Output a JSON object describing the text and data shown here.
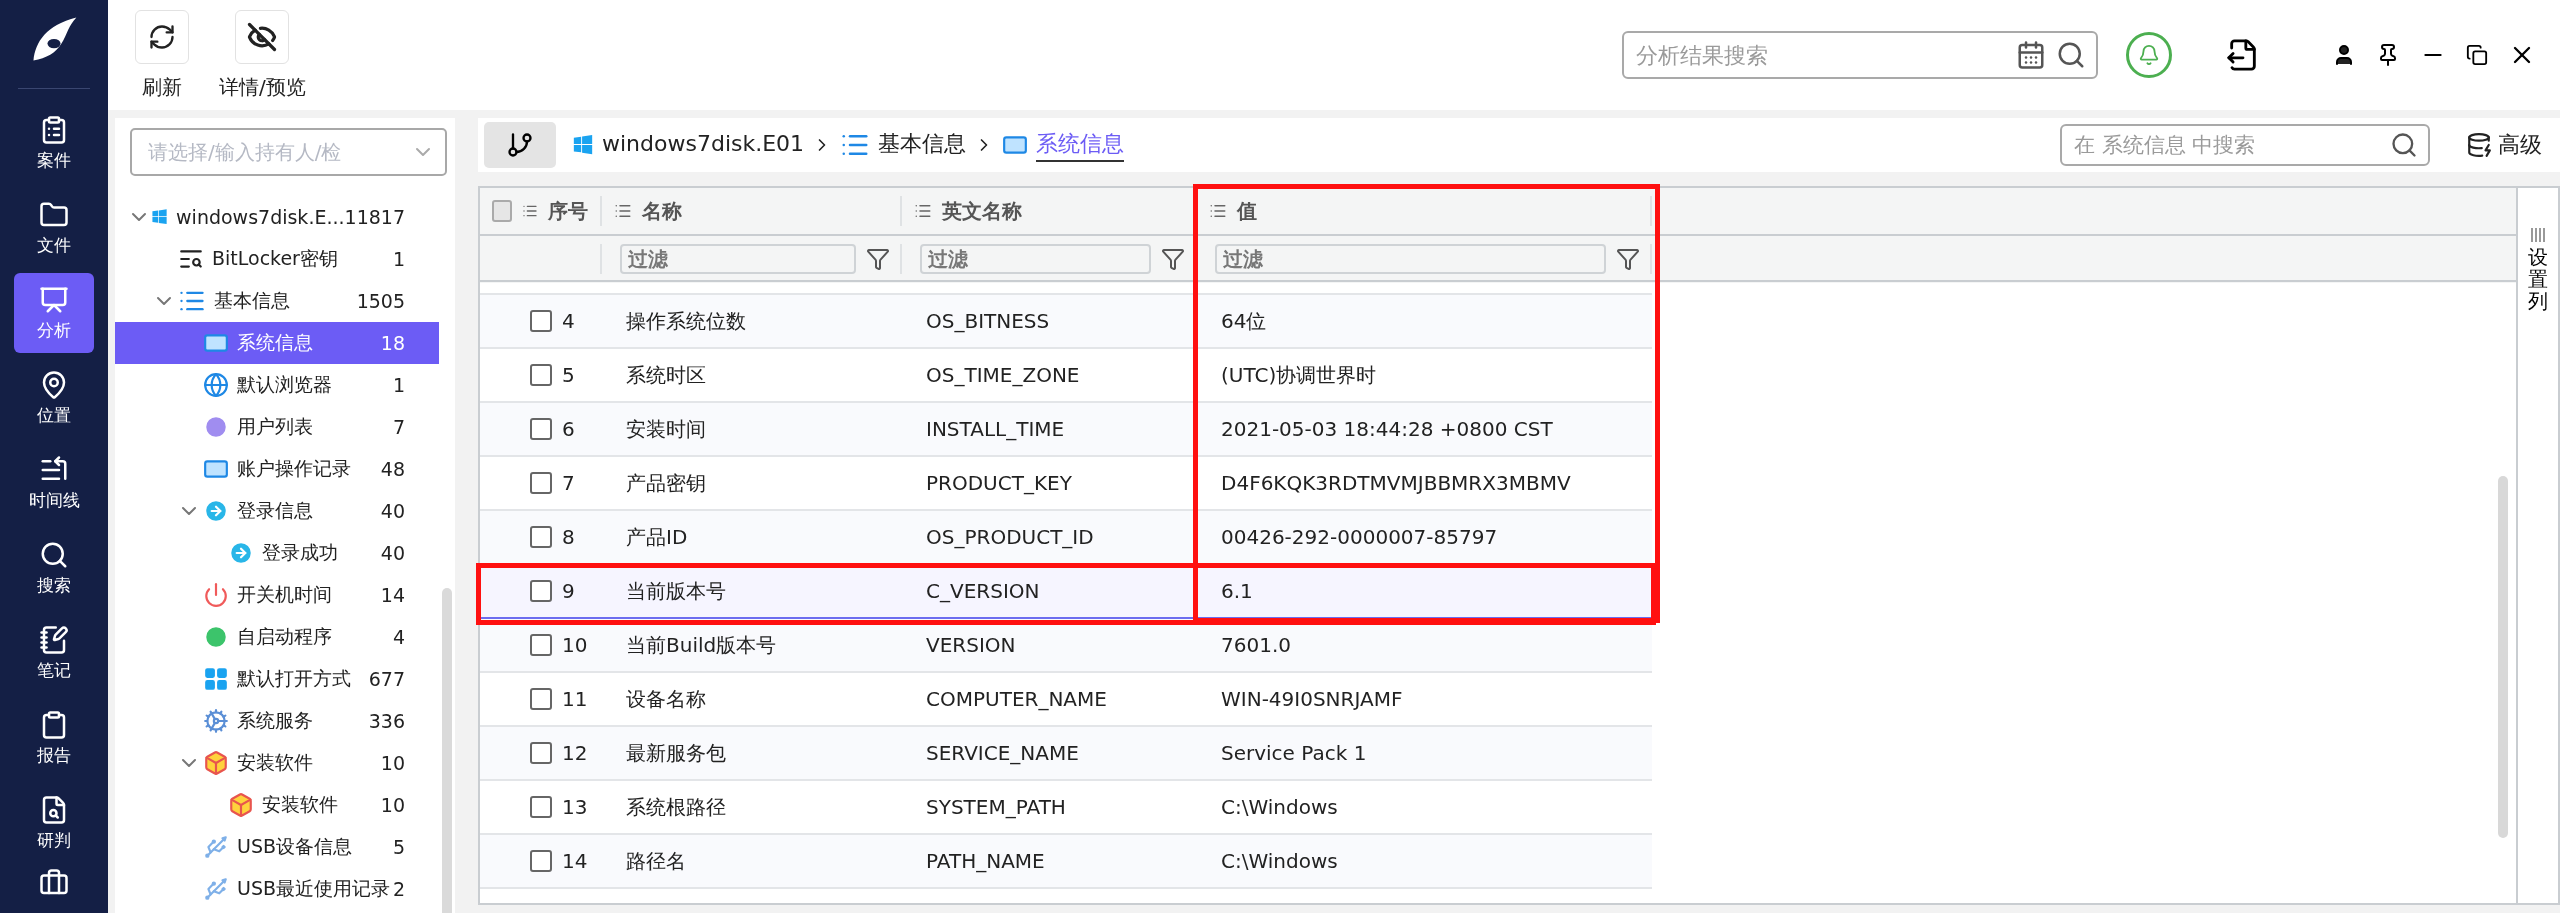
{
  "toolbar": {
    "buttons": [
      {
        "label": "刷新"
      },
      {
        "label": "详情/预览"
      }
    ]
  },
  "top_search": {
    "placeholder": "分析结果搜索"
  },
  "nav": [
    {
      "label": "案件",
      "selected": false
    },
    {
      "label": "文件",
      "selected": false
    },
    {
      "label": "分析",
      "selected": true
    },
    {
      "label": "位置",
      "selected": false
    },
    {
      "label": "时间线",
      "selected": false
    },
    {
      "label": "搜索",
      "selected": false
    },
    {
      "label": "笔记",
      "selected": false
    },
    {
      "label": "报告",
      "selected": false
    },
    {
      "label": "研判",
      "selected": false
    }
  ],
  "tree": {
    "placeholder": "请选择/输入持有人/检",
    "items": [
      {
        "label": "windows7disk.E...",
        "count": "11817",
        "selected": false,
        "expanded": true,
        "children": [
          {
            "label": "BitLocker密钥",
            "count": "1",
            "selected": false
          },
          {
            "label": "基本信息",
            "count": "1505",
            "selected": false,
            "expanded": true,
            "children": [
              {
                "label": "系统信息",
                "count": "18",
                "selected": true
              },
              {
                "label": "默认浏览器",
                "count": "1",
                "selected": false
              },
              {
                "label": "用户列表",
                "count": "7",
                "selected": false
              },
              {
                "label": "账户操作记录",
                "count": "48",
                "selected": false
              },
              {
                "label": "登录信息",
                "count": "40",
                "selected": false,
                "expanded": true,
                "children": [
                  {
                    "label": "登录成功",
                    "count": "40",
                    "selected": false
                  }
                ]
              },
              {
                "label": "开关机时间",
                "count": "14",
                "selected": false
              },
              {
                "label": "自启动程序",
                "count": "4",
                "selected": false
              },
              {
                "label": "默认打开方式",
                "count": "677",
                "selected": false
              },
              {
                "label": "系统服务",
                "count": "336",
                "selected": false
              },
              {
                "label": "安装软件",
                "count": "10",
                "selected": false,
                "expanded": true,
                "children": [
                  {
                    "label": "安装软件",
                    "count": "10",
                    "selected": false
                  }
                ]
              },
              {
                "label": "USB设备信息",
                "count": "5",
                "selected": false
              },
              {
                "label": "USB最近使用记录",
                "count": "2",
                "selected": false
              }
            ]
          }
        ]
      }
    ]
  },
  "breadcrumb": [
    {
      "label": "windows7disk.E01",
      "selected": false
    },
    {
      "label": "基本信息",
      "selected": false
    },
    {
      "label": "系统信息",
      "selected": true
    }
  ],
  "table_search": {
    "placeholder": "在 系统信息 中搜索"
  },
  "advanced_button": "高级",
  "table": {
    "all_checked": false,
    "columns": [
      {
        "label": "序号",
        "outlined": false
      },
      {
        "label": "名称",
        "filter_placeholder": "过滤",
        "outlined": false
      },
      {
        "label": "英文名称",
        "filter_placeholder": "过滤",
        "outlined": false
      },
      {
        "label": "值",
        "filter_placeholder": "过滤",
        "outlined": true
      }
    ],
    "rows": [
      {
        "index": "4",
        "name": "操作系统位数",
        "english_name": "OS_BITNESS",
        "value": "64位",
        "checked": false,
        "selected": false,
        "outlined": false
      },
      {
        "index": "5",
        "name": "系统时区",
        "english_name": "OS_TIME_ZONE",
        "value": "(UTC)协调世界时",
        "checked": false,
        "selected": false,
        "outlined": false
      },
      {
        "index": "6",
        "name": "安装时间",
        "english_name": "INSTALL_TIME",
        "value": "2021-05-03 18:44:28 +0800 CST",
        "checked": false,
        "selected": false,
        "outlined": false
      },
      {
        "index": "7",
        "name": "产品密钥",
        "english_name": "PRODUCT_KEY",
        "value": "D4F6KQK3RDTMVMJBBMRX3MBMV",
        "checked": false,
        "selected": false,
        "outlined": false
      },
      {
        "index": "8",
        "name": "产品ID",
        "english_name": "OS_PRODUCT_ID",
        "value": "00426-292-0000007-85797",
        "checked": false,
        "selected": false,
        "outlined": false
      },
      {
        "index": "9",
        "name": "当前版本号",
        "english_name": "C_VERSION",
        "value": "6.1",
        "checked": false,
        "selected": true,
        "outlined": true
      },
      {
        "index": "10",
        "name": "当前Build版本号",
        "english_name": "VERSION",
        "value": "7601.0",
        "checked": false,
        "selected": false,
        "outlined": false
      },
      {
        "index": "11",
        "name": "设备名称",
        "english_name": "COMPUTER_NAME",
        "value": "WIN-49I0SNRJAMF",
        "checked": false,
        "selected": false,
        "outlined": false
      },
      {
        "index": "12",
        "name": "最新服务包",
        "english_name": "SERVICE_NAME",
        "value": "Service Pack 1",
        "checked": false,
        "selected": false,
        "outlined": false
      },
      {
        "index": "13",
        "name": "系统根路径",
        "english_name": "SYSTEM_PATH",
        "value": "C:\\Windows",
        "checked": false,
        "selected": false,
        "outlined": false
      },
      {
        "index": "14",
        "name": "路径名",
        "english_name": "PATH_NAME",
        "value": "C:\\Windows",
        "checked": false,
        "selected": false,
        "outlined": false
      }
    ]
  },
  "column_settings": "设置列"
}
